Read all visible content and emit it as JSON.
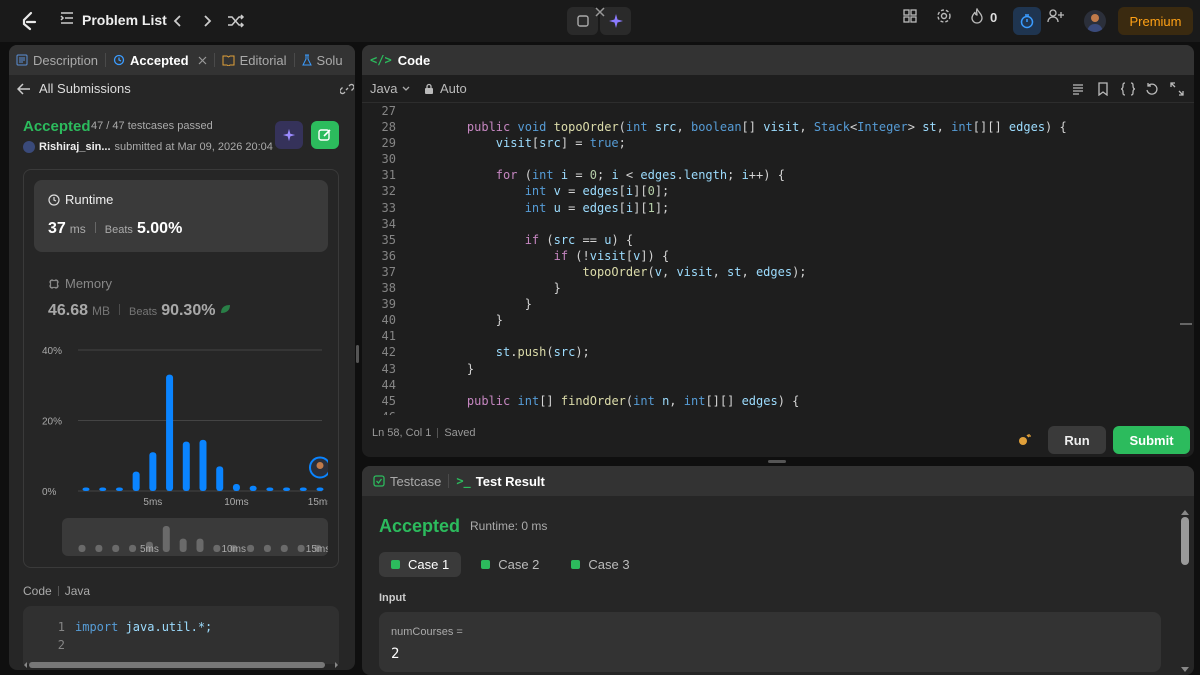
{
  "topbar": {
    "problem_list_label": "Problem List",
    "streak_count": "0",
    "premium_label": "Premium"
  },
  "left_tabs": [
    {
      "label": "Description"
    },
    {
      "label": "Accepted"
    },
    {
      "label": "Editorial"
    },
    {
      "label": "Solu"
    }
  ],
  "submission": {
    "all_submissions_label": "All Submissions",
    "status": "Accepted",
    "testcases": "47 / 47 testcases passed",
    "user": "Rishiraj_sin...",
    "submitted_text": "submitted at Mar 09, 2026 20:04",
    "runtime": {
      "label": "Runtime",
      "value": "37",
      "unit": "ms",
      "beats_label": "Beats",
      "beats": "5.00%"
    },
    "memory": {
      "label": "Memory",
      "value": "46.68",
      "unit": "MB",
      "beats_label": "Beats",
      "beats": "90.30%"
    }
  },
  "chart_data": {
    "type": "bar",
    "x_tick_labels": [
      "5ms",
      "10ms",
      "15ms"
    ],
    "y_tick_labels": [
      "40%",
      "20%",
      "0%"
    ],
    "ylim": [
      0,
      40
    ],
    "x": [
      1,
      2,
      3,
      4,
      5,
      6,
      7,
      8,
      9,
      10,
      11,
      12,
      13,
      14,
      15
    ],
    "values": [
      1,
      1,
      1,
      5.5,
      11,
      33,
      14,
      14.5,
      7,
      2,
      1.5,
      1,
      1,
      1,
      1
    ],
    "minimap_values": [
      1,
      1,
      1,
      1,
      2,
      7,
      3,
      3,
      1,
      1,
      1,
      1,
      1,
      1,
      1
    ],
    "minimap_tick_labels": [
      "5ms",
      "10ms",
      "15ms"
    ],
    "bar_color": "#0a84ff",
    "grid": true
  },
  "code_preview": {
    "label": "Code",
    "language": "Java",
    "lines": [
      {
        "n": "1",
        "kw": "import",
        "rest": " java.util.*;"
      },
      {
        "n": "2",
        "kw": "",
        "rest": ""
      }
    ]
  },
  "editor": {
    "title": "Code",
    "language": "Java",
    "auto_label": "Auto",
    "status_pos": "Ln 58, Col 1",
    "status_saved": "Saved",
    "run_label": "Run",
    "submit_label": "Submit",
    "lines": [
      {
        "n": "27",
        "html": ""
      },
      {
        "n": "28",
        "html": "    <span class='kw'>public</span> <span class='ty'>void</span> <span class='fn'>topoOrder</span>(<span class='ty'>int</span> <span class='vr'>src</span>, <span class='ty'>boolean</span>[] <span class='vr'>visit</span>, <span class='ty'>Stack</span>&lt;<span class='ty'>Integer</span>&gt; <span class='vr'>st</span>, <span class='ty'>int</span>[][] <span class='vr'>edges</span>) {"
      },
      {
        "n": "29",
        "html": "        <span class='vr'>visit</span>[<span class='vr'>src</span>] = <span class='ty'>true</span>;"
      },
      {
        "n": "30",
        "html": ""
      },
      {
        "n": "31",
        "html": "        <span class='kw'>for</span> (<span class='ty'>int</span> <span class='vr'>i</span> = <span class='nm'>0</span>; <span class='vr'>i</span> &lt; <span class='vr'>edges</span>.<span class='vr'>length</span>; <span class='vr'>i</span>++) {"
      },
      {
        "n": "32",
        "html": "            <span class='ty'>int</span> <span class='vr'>v</span> = <span class='vr'>edges</span>[<span class='vr'>i</span>][<span class='nm'>0</span>];"
      },
      {
        "n": "33",
        "html": "            <span class='ty'>int</span> <span class='vr'>u</span> = <span class='vr'>edges</span>[<span class='vr'>i</span>][<span class='nm'>1</span>];"
      },
      {
        "n": "34",
        "html": ""
      },
      {
        "n": "35",
        "html": "            <span class='kw'>if</span> (<span class='vr'>src</span> == <span class='vr'>u</span>) {"
      },
      {
        "n": "36",
        "html": "                <span class='kw'>if</span> (!<span class='vr'>visit</span>[<span class='vr'>v</span>]) {"
      },
      {
        "n": "37",
        "html": "                    <span class='fn'>topoOrder</span>(<span class='vr'>v</span>, <span class='vr'>visit</span>, <span class='vr'>st</span>, <span class='vr'>edges</span>);"
      },
      {
        "n": "38",
        "html": "                }"
      },
      {
        "n": "39",
        "html": "            }"
      },
      {
        "n": "40",
        "html": "        }"
      },
      {
        "n": "41",
        "html": ""
      },
      {
        "n": "42",
        "html": "        <span class='vr'>st</span>.<span class='fn'>push</span>(<span class='vr'>src</span>);"
      },
      {
        "n": "43",
        "html": "    }"
      },
      {
        "n": "44",
        "html": ""
      },
      {
        "n": "45",
        "html": "    <span class='kw'>public</span> <span class='ty'>int</span>[] <span class='fn'>findOrder</span>(<span class='ty'>int</span> <span class='vr'>n</span>, <span class='ty'>int</span>[][] <span class='vr'>edges</span>) {"
      },
      {
        "n": "46",
        "html": ""
      }
    ]
  },
  "result": {
    "testcase_tab": "Testcase",
    "result_tab": "Test Result",
    "status": "Accepted",
    "runtime": "Runtime: 0 ms",
    "cases": [
      {
        "label": "Case 1"
      },
      {
        "label": "Case 2"
      },
      {
        "label": "Case 3"
      }
    ],
    "input_label": "Input",
    "input_name": "numCourses =",
    "input_value": "2"
  }
}
